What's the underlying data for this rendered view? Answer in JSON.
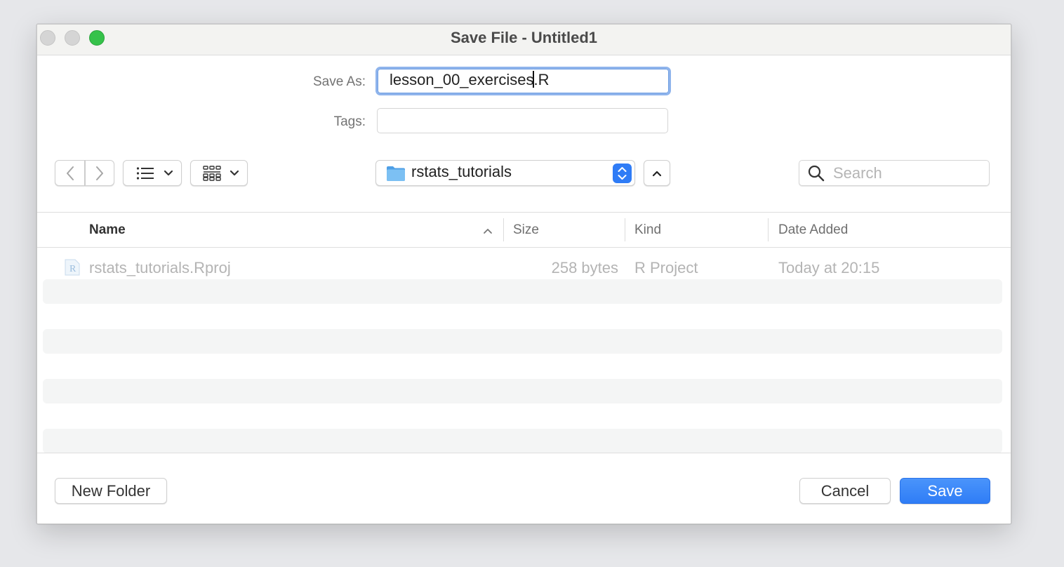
{
  "window": {
    "title": "Save File - Untitled1"
  },
  "form": {
    "save_as_label": "Save As:",
    "save_as_value_before_caret": "lesson_00_exercises",
    "save_as_value_after_caret": ".R",
    "tags_label": "Tags:",
    "tags_value": ""
  },
  "toolbar": {
    "location": "rstats_tutorials",
    "search_placeholder": "Search"
  },
  "table": {
    "columns": [
      "Name",
      "Size",
      "Kind",
      "Date Added"
    ],
    "sort_column": "Name",
    "rows": [
      {
        "name": "rstats_tutorials.Rproj",
        "size": "258 bytes",
        "kind": "R Project",
        "date_added": "Today at 20:15",
        "icon": "r-project-file-icon",
        "enabled": false
      }
    ]
  },
  "footer": {
    "new_folder_label": "New Folder",
    "cancel_label": "Cancel",
    "save_label": "Save"
  },
  "colors": {
    "accent": "#2f7cf6",
    "focus_ring": "#8fb4ec",
    "zoom_button": "#35c24a",
    "folder": "#5aa9ec"
  }
}
